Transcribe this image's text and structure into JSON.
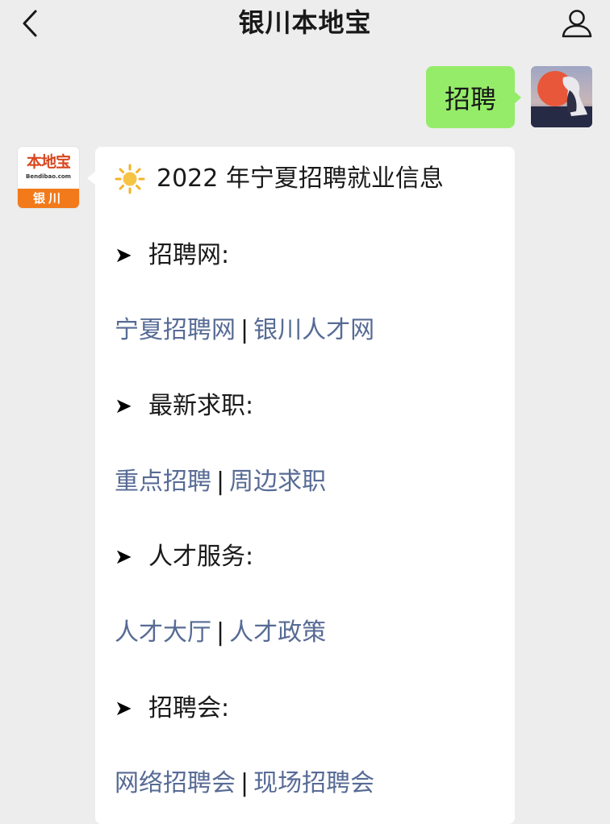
{
  "header": {
    "title": "银川本地宝",
    "back_icon": "chevron-left-icon",
    "profile_icon": "user-icon"
  },
  "sent_message": {
    "text": "招聘",
    "bubble_color": "#95ec69"
  },
  "bot_avatar": {
    "brand": "本地宝",
    "url": "Bendibao.com",
    "city": "银川",
    "accent_color": "#f27a1a"
  },
  "reply": {
    "title_icon": "sun-icon",
    "title": "2022 年宁夏招聘就业信息",
    "sections": [
      {
        "heading": "招聘网:",
        "links": [
          "宁夏招聘网",
          "银川人才网"
        ]
      },
      {
        "heading": "最新求职:",
        "links": [
          "重点招聘",
          "周边求职"
        ]
      },
      {
        "heading": "人才服务:",
        "links": [
          "人才大厅",
          "人才政策"
        ]
      },
      {
        "heading": "招聘会:",
        "links": [
          "网络招聘会",
          "现场招聘会"
        ]
      }
    ],
    "arrow_glyph": "➤",
    "separator": "|",
    "link_color": "#576b95"
  }
}
